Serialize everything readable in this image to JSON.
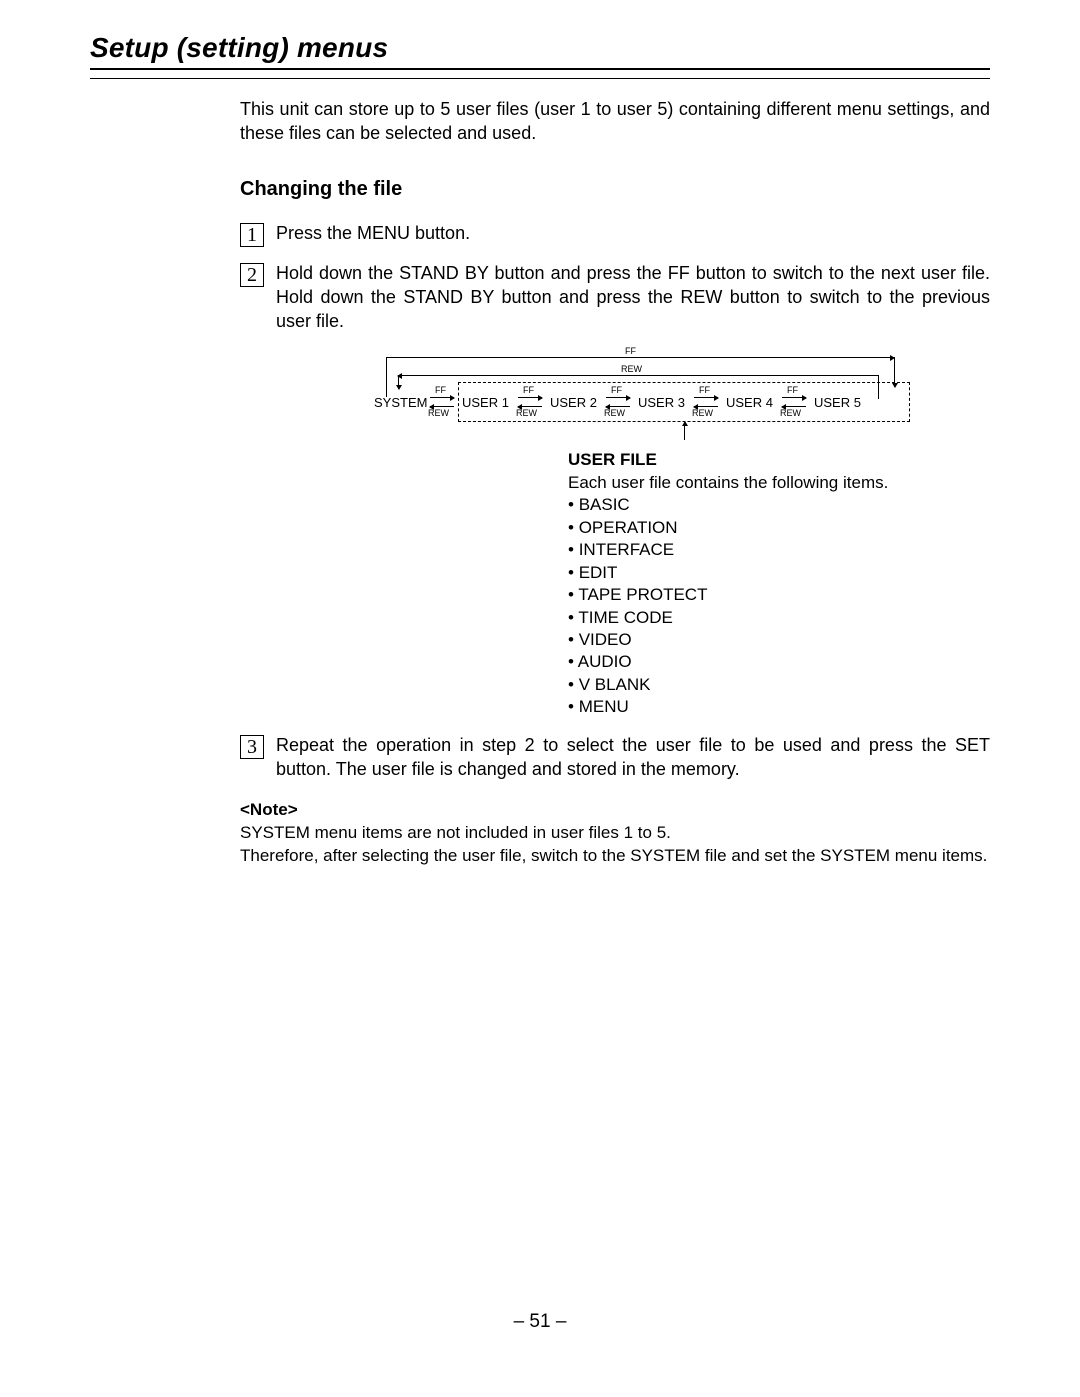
{
  "title": "Setup (setting) menus",
  "intro": "This unit can store up to 5 user files (user 1 to user 5) containing different menu settings, and these files can be selected and used.",
  "subhead": "Changing the file",
  "steps": {
    "1": "Press the MENU button.",
    "2": "Hold down the STAND BY button and press the FF button to switch to the next user file. Hold down the STAND BY button and press the REW button to switch to the previous user file.",
    "3": "Repeat the operation in step 2 to select the user file to be used and press the SET button. The user file is changed and stored in the memory."
  },
  "diagram": {
    "ff_top": "FF",
    "rew_top": "REW",
    "nodes": [
      "SYSTEM",
      "USER 1",
      "USER 2",
      "USER 3",
      "USER 4",
      "USER 5"
    ],
    "ff": "FF",
    "rew": "REW"
  },
  "userfile": {
    "heading": "USER FILE",
    "desc": "Each user file contains the following items.",
    "items": [
      "BASIC",
      "OPERATION",
      "INTERFACE",
      "EDIT",
      "TAPE PROTECT",
      "TIME CODE",
      "VIDEO",
      "AUDIO",
      "V BLANK",
      "MENU"
    ]
  },
  "note": {
    "heading": "<Note>",
    "body": "SYSTEM menu items are not included in user files 1 to 5.\nTherefore, after selecting the user file, switch to the SYSTEM file and set the SYSTEM menu items."
  },
  "pagenum": "– 51 –"
}
